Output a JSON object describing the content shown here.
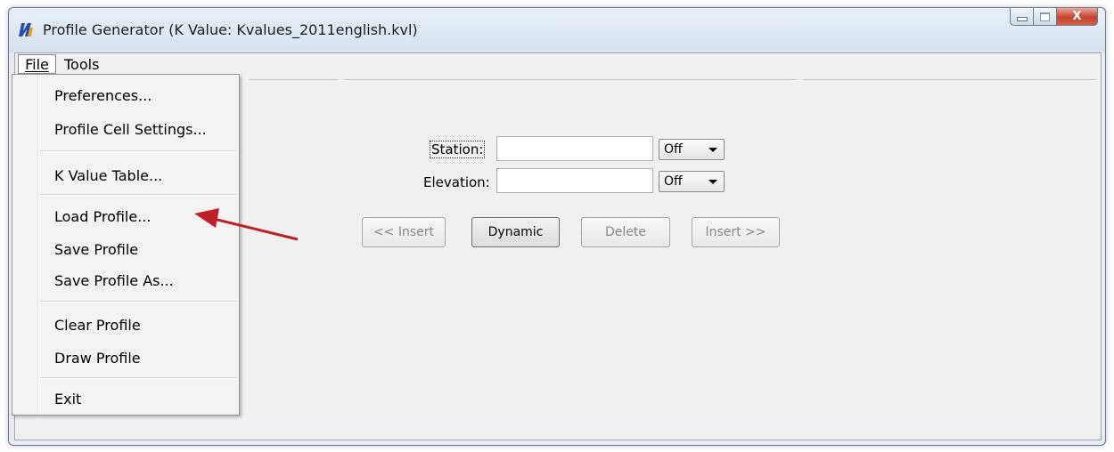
{
  "window": {
    "title": "Profile Generator  (K Value: Kvalues_2011english.kvl)",
    "close_glyph": "X"
  },
  "menubar": {
    "file_label": "File",
    "tools_label": "Tools"
  },
  "file_menu": {
    "items": [
      "Preferences...",
      "Profile Cell Settings...",
      "K Value Table...",
      "Load Profile...",
      "Save Profile",
      "Save Profile As...",
      "Clear Profile",
      "Draw Profile",
      "Exit"
    ]
  },
  "form": {
    "station_label": "Station:",
    "station_value": "",
    "station_mode": "Off",
    "elevation_label": "Elevation:",
    "elevation_value": "",
    "elevation_mode": "Off"
  },
  "buttons": {
    "insert_before": "<< Insert",
    "dynamic": "Dynamic",
    "delete": "Delete",
    "insert_after": "Insert >>"
  },
  "colors": {
    "annotation_arrow": "#c0202a",
    "close_button": "#c8452f",
    "app_icon": "#2b4fa8"
  },
  "icons": {
    "app": "profile-generator-icon",
    "minimize": "minimize-icon",
    "maximize": "maximize-icon",
    "close": "close-icon",
    "combo_arrow": "dropdown-arrow-icon"
  }
}
